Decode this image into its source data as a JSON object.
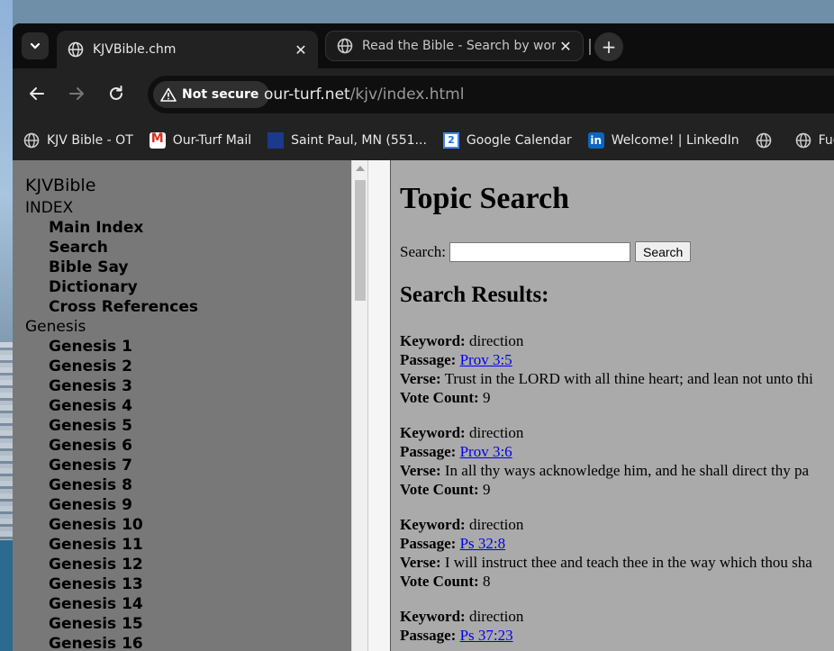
{
  "browser": {
    "tabs": [
      {
        "title": "KJVBible.chm",
        "active": true
      },
      {
        "title": "Read the Bible - Search by word",
        "active": false
      }
    ],
    "security_label": "Not secure",
    "url_host": "our-turf.net",
    "url_path": "/kjv/index.html",
    "bookmarks": [
      {
        "label": "KJV Bible - OT",
        "icon": "globe-icon"
      },
      {
        "label": "Our-Turf Mail",
        "icon": "gmail-icon"
      },
      {
        "label": "Saint Paul, MN (551...",
        "icon": "weather-channel-icon"
      },
      {
        "label": "Google Calendar",
        "icon": "google-calendar-icon"
      },
      {
        "label": "Welcome! | LinkedIn",
        "icon": "linkedin-icon"
      },
      {
        "label": "",
        "icon": "globe-icon"
      },
      {
        "label": "Fue",
        "icon": "globe-icon"
      }
    ]
  },
  "toc": {
    "title": "KJVBible",
    "sections": [
      {
        "label": "INDEX",
        "items": [
          "Main Index",
          "Search",
          "Bible Say",
          "Dictionary",
          "Cross References"
        ]
      },
      {
        "label": "Genesis",
        "items": [
          "Genesis 1",
          "Genesis 2",
          "Genesis 3",
          "Genesis 4",
          "Genesis 5",
          "Genesis 6",
          "Genesis 7",
          "Genesis 8",
          "Genesis 9",
          "Genesis 10",
          "Genesis 11",
          "Genesis 12",
          "Genesis 13",
          "Genesis 14",
          "Genesis 15",
          "Genesis 16"
        ]
      }
    ]
  },
  "page": {
    "heading": "Topic Search",
    "search_label": "Search:",
    "search_value": "",
    "search_button": "Search",
    "results_heading": "Search Results:",
    "field_labels": {
      "keyword": "Keyword:",
      "passage": "Passage:",
      "verse": "Verse:",
      "votes": "Vote Count:"
    },
    "results": [
      {
        "keyword": "direction",
        "passage": "Prov 3:5",
        "verse": "Trust in the LORD with all thine heart; and lean not unto thi",
        "votes": "9"
      },
      {
        "keyword": "direction",
        "passage": "Prov 3:6",
        "verse": "In all thy ways acknowledge him, and he shall direct thy pa",
        "votes": "9"
      },
      {
        "keyword": "direction",
        "passage": "Ps 32:8",
        "verse": "I will instruct thee and teach thee in the way which thou sha",
        "votes": "8"
      },
      {
        "keyword": "direction",
        "passage": "Ps 37:23",
        "verse": "",
        "votes": ""
      }
    ]
  }
}
